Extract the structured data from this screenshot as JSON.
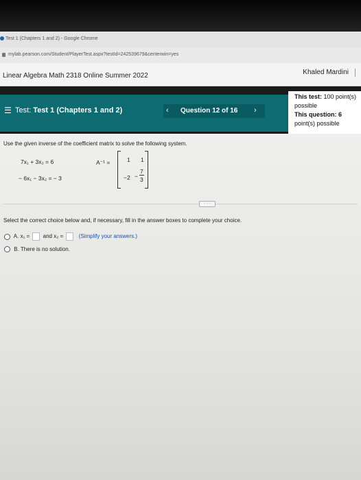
{
  "browser": {
    "window_title": "Test 1 (Chapters 1 and 2) - Google Chrome",
    "url": "mylab.pearson.com/Student/PlayerTest.aspx?testId=242539679&centerwin=yes"
  },
  "header": {
    "course": "Linear Algebra Math 2318 Online Summer 2022",
    "user": "Khaled Mardini"
  },
  "testbar": {
    "menu_icon": "hamburger-icon",
    "test_label": "Test:",
    "test_name": "Test 1 (Chapters 1 and 2)",
    "question_label": "Question 12 of 16",
    "prev_icon": "chevron-left-icon",
    "next_icon": "chevron-right-icon"
  },
  "score": {
    "test_label": "This test:",
    "test_value": "100 point(s)",
    "test_possible": "possible",
    "question_label": "This question:",
    "question_value": "6",
    "question_possible": "point(s) possible"
  },
  "question": {
    "instruction": "Use the given inverse of the coefficient matrix to solve the following system.",
    "eq1": "7x₁ + 3x₂ = 6",
    "eq2": "− 6x₁ − 3x₂ = − 3",
    "ainv_label": "A⁻¹ =",
    "matrix": {
      "m11": "1",
      "m12": "1",
      "m21": "−2",
      "m22_sign": "−",
      "m22_num": "7",
      "m22_den": "3"
    },
    "more_label": "· · ·",
    "prompt": "Select the correct choice below and, if necessary, fill in the answer boxes to complete your choice.",
    "choiceA": {
      "letter": "A.",
      "x1_label": "x₁ =",
      "and": "and x₂ =",
      "hint": "(Simplify your answers.)"
    },
    "choiceB": {
      "letter": "B.",
      "text": "There is no solution."
    }
  }
}
